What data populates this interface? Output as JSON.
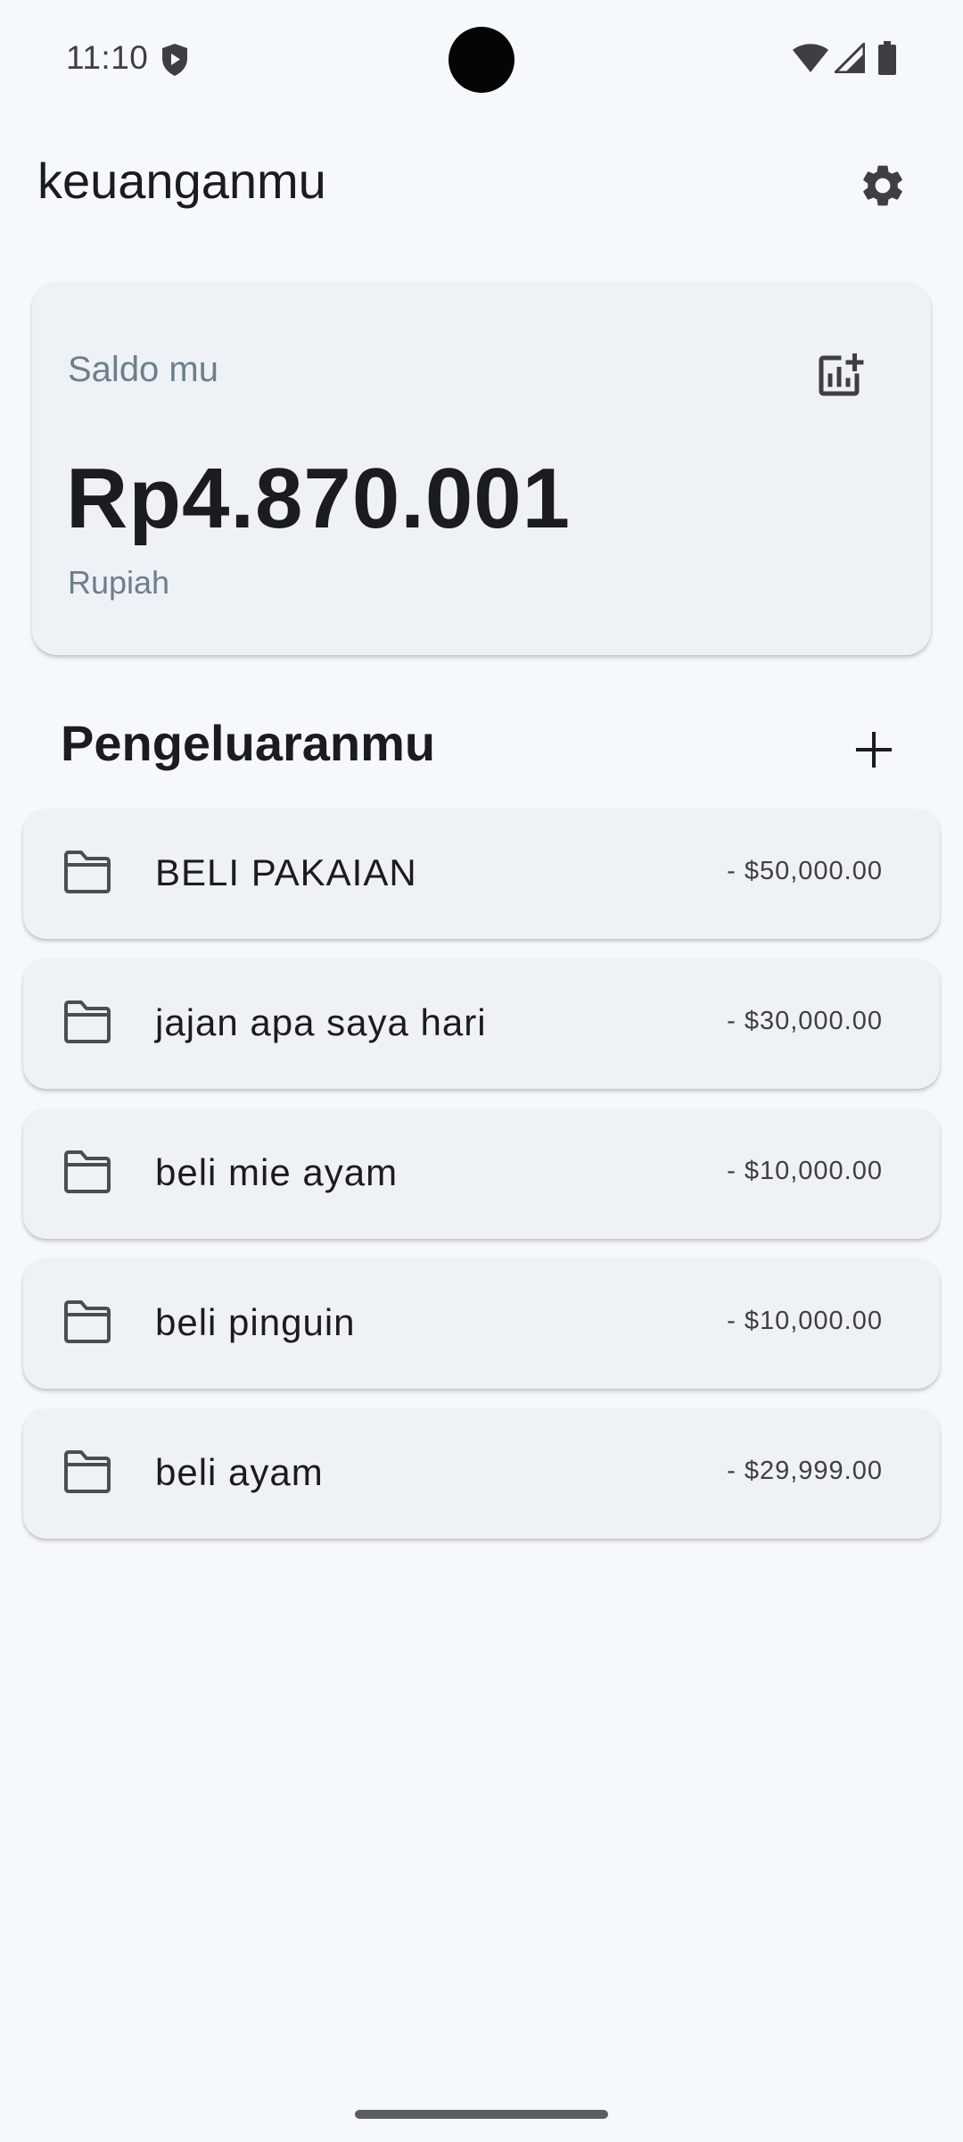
{
  "status_bar": {
    "time": "11:10",
    "icons": [
      "shield-play-icon",
      "wifi-icon",
      "signal-icon",
      "battery-icon"
    ]
  },
  "app_bar": {
    "title": "keuanganmu",
    "settings_icon": "gear-icon"
  },
  "balance_card": {
    "label": "Saldo mu",
    "amount": "Rp4.870.001",
    "currency": "Rupiah",
    "action_icon": "add-chart-icon"
  },
  "expenses": {
    "title": "Pengeluaranmu",
    "add_icon": "plus-icon",
    "items": [
      {
        "title": "BELI PAKAIAN",
        "amount": "- $50,000.00",
        "icon": "folder-icon"
      },
      {
        "title": "jajan apa saya hari",
        "amount": "- $30,000.00",
        "icon": "folder-icon"
      },
      {
        "title": "beli mie ayam",
        "amount": "- $10,000.00",
        "icon": "folder-icon"
      },
      {
        "title": "beli pinguin",
        "amount": "- $10,000.00",
        "icon": "folder-icon"
      },
      {
        "title": "beli ayam",
        "amount": "- $29,999.00",
        "icon": "folder-icon"
      }
    ]
  },
  "colors": {
    "background": "#f6f9fc",
    "card": "#eef2f7",
    "text_primary": "#1b1c1e",
    "text_secondary": "#6c7f8d"
  }
}
